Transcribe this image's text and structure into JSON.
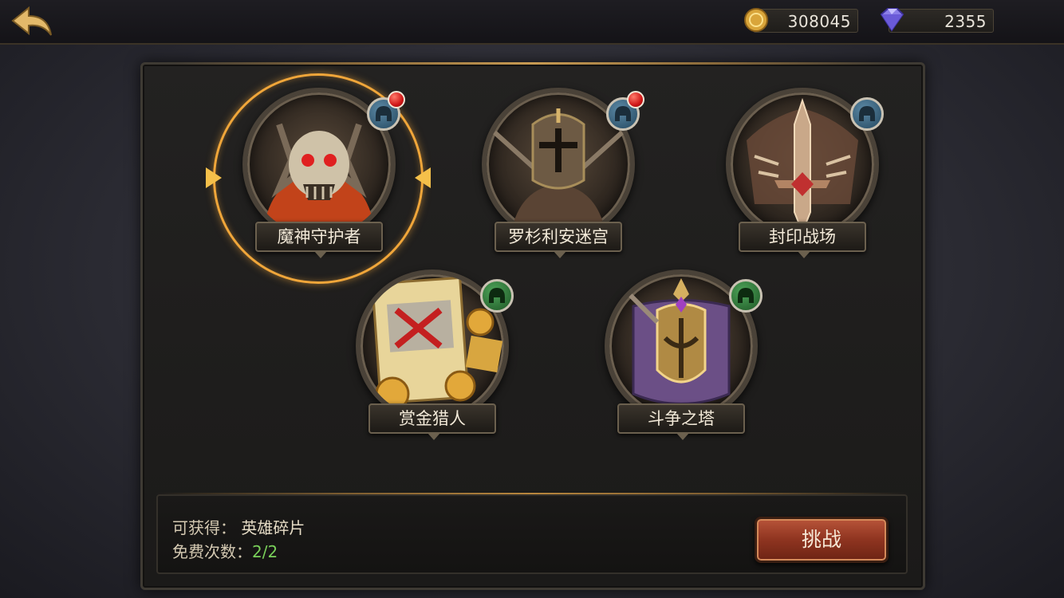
{
  "header": {
    "gold": "308045",
    "diamonds": "2355",
    "gold_icon": "gold-coin-icon",
    "diamond_icon": "diamond-icon",
    "back_icon": "back-arrow-icon"
  },
  "modes": [
    {
      "label": "魔神守护者",
      "badge": "blue",
      "has_alert": true,
      "selected": true
    },
    {
      "label": "罗杉利安迷宫",
      "badge": "blue",
      "has_alert": true,
      "selected": false
    },
    {
      "label": "封印战场",
      "badge": "blue",
      "has_alert": false,
      "selected": false
    },
    {
      "label": "赏金猎人",
      "badge": "green",
      "has_alert": false,
      "selected": false
    },
    {
      "label": "斗争之塔",
      "badge": "green",
      "has_alert": false,
      "selected": false
    }
  ],
  "info": {
    "reward_label": "可获得：",
    "reward_value": "英雄碎片",
    "free_label": "免费次数：",
    "free_value": "2/2",
    "challenge_button": "挑战"
  },
  "colors": {
    "selection_ring": "#f0a63a",
    "alert_dot": "#d01818",
    "blue_badge": "#22465e",
    "green_badge": "#1c5524",
    "button": "#8e3420"
  }
}
